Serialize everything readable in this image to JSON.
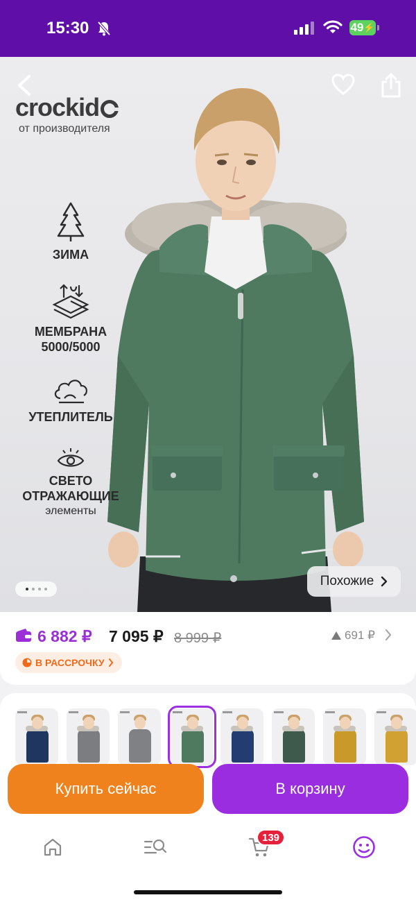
{
  "status_bar": {
    "time": "15:30",
    "battery": "49"
  },
  "hero": {
    "brand": "crockid",
    "brand_subtitle": "от производителя",
    "features": [
      {
        "icon": "snowflake-tree-icon",
        "label": "ЗИМА"
      },
      {
        "icon": "membrane-icon",
        "label": "МЕМБРАНА",
        "label2": "5000/5000"
      },
      {
        "icon": "cloud-icon",
        "label": "УТЕПЛИТЕЛЬ"
      },
      {
        "icon": "eye-icon",
        "label": "СВЕТО",
        "label2": "ОТРАЖАЮЩИЕ",
        "label3": "элементы"
      }
    ],
    "similar_label": "Похожие",
    "page_indicator": {
      "total": 4,
      "current": 1
    }
  },
  "price": {
    "wallet_price": "6 882 ₽",
    "price": "7 095 ₽",
    "old_price": "8 999 ₽",
    "points": "691 ₽",
    "installment": "В РАССРОЧКУ"
  },
  "variants": [
    {
      "color": "#1f3760",
      "fur": true
    },
    {
      "color": "#7b7d80",
      "fur": true
    },
    {
      "color": "#7f8184",
      "fur": false
    },
    {
      "color": "#4f7a60",
      "fur": true,
      "selected": true
    },
    {
      "color": "#233d72",
      "fur": true
    },
    {
      "color": "#3d5a4d",
      "fur": true
    },
    {
      "color": "#c99a2a",
      "fur": true
    },
    {
      "color": "#d1a232",
      "fur": true
    }
  ],
  "actions": {
    "buy_now": "Купить сейчас",
    "add_to_cart": "В корзину"
  },
  "nav": {
    "cart_count": "139"
  },
  "colors": {
    "brand_purple": "#5f0fa8",
    "accent_purple": "#9b2de0",
    "accent_orange": "#f0821e",
    "jacket_green": "#4f7a60"
  }
}
